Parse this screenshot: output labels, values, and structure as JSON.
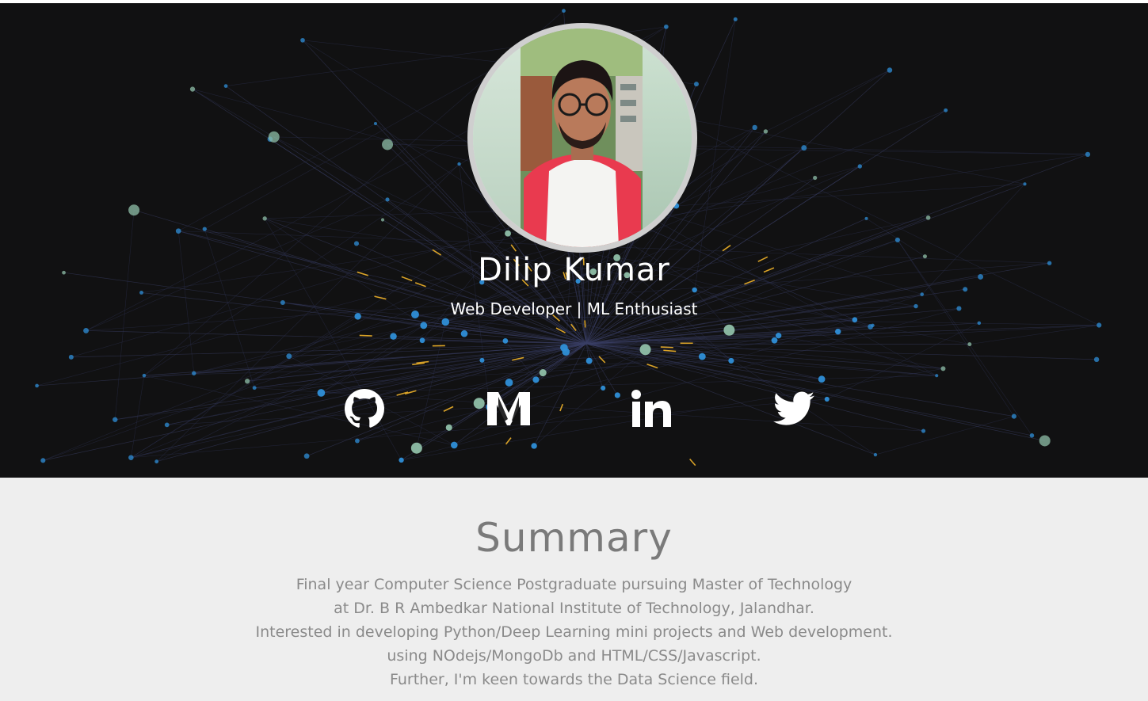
{
  "profile": {
    "name": "Dilip Kumar",
    "tagline": "Web Developer | ML Enthusiast"
  },
  "social": [
    {
      "icon": "github-icon"
    },
    {
      "icon": "medium-icon"
    },
    {
      "icon": "linkedin-icon"
    },
    {
      "icon": "twitter-icon"
    }
  ],
  "summary": {
    "title": "Summary",
    "lines": [
      "Final year Computer Science Postgraduate pursuing Master of Technology",
      "at Dr. B R Ambedkar National Institute of Technology, Jalandhar.",
      "Interested in developing Python/Deep Learning mini projects and Web development.",
      "using NOdejs/MongoDb and HTML/CSS/Javascript.",
      "Further, I'm keen towards the Data Science field."
    ]
  },
  "colors": {
    "hero_bg": "#111112",
    "summary_bg": "#eeeeee",
    "node_blue": "#2f8fd8",
    "node_green": "#8fbfa8",
    "node_gold": "#d9a227"
  }
}
